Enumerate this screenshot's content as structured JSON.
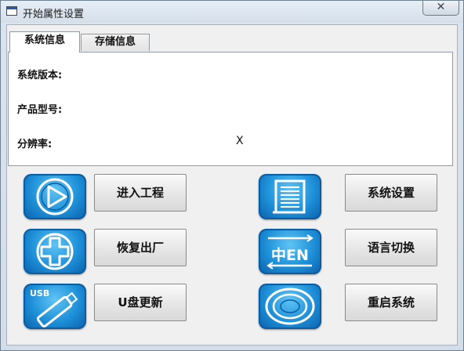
{
  "window": {
    "title": "开始属性设置",
    "close_glyph": "✕"
  },
  "tabs": [
    {
      "label": "系统信息",
      "active": true
    },
    {
      "label": "存储信息",
      "active": false
    }
  ],
  "info": {
    "version_label": "系统版本:",
    "model_label": "产品型号:",
    "resolution_label": "分辨率:",
    "resolution_value": "X"
  },
  "actions": [
    {
      "label": "进入工程",
      "icon": "play-icon"
    },
    {
      "label": "恢复出厂",
      "icon": "plus-icon"
    },
    {
      "label": "U盘更新",
      "icon": "usb-icon",
      "icon_text": "USB"
    },
    {
      "label": "系统设置",
      "icon": "settings-list-icon"
    },
    {
      "label": "语言切换",
      "icon": "language-icon",
      "icon_text": "中EN"
    },
    {
      "label": "重启系统",
      "icon": "restart-icon"
    }
  ],
  "colors": {
    "tile_blue": "#1d8fd8",
    "tile_light": "#5fc4f4"
  }
}
